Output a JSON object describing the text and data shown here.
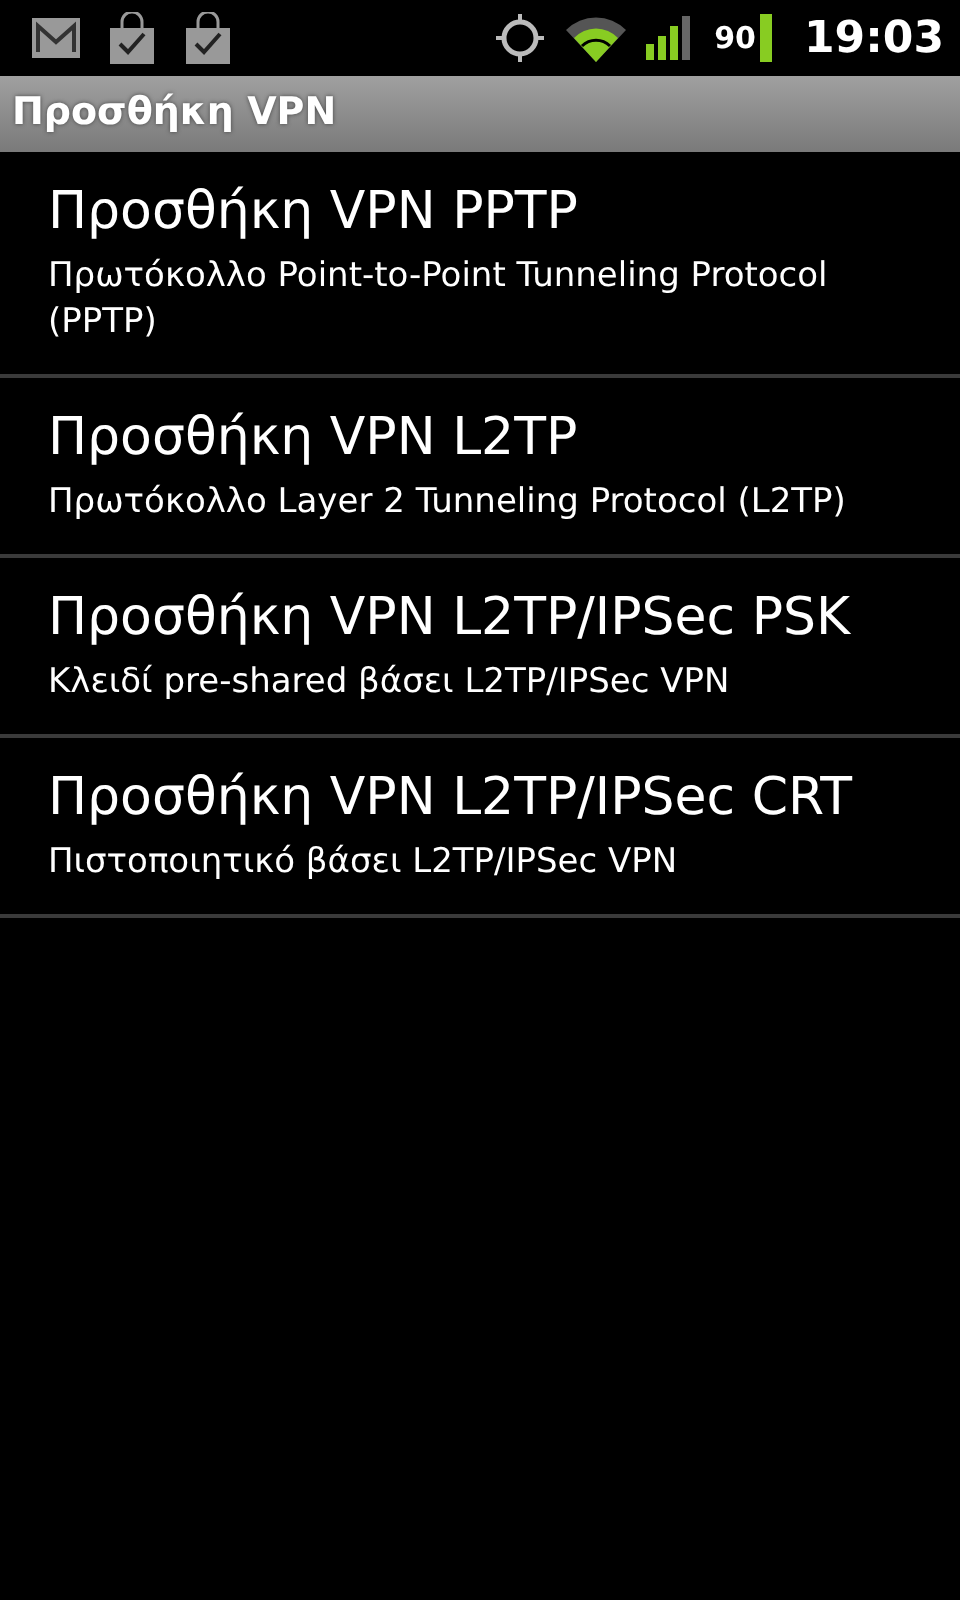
{
  "status_bar": {
    "battery_percent": "90",
    "time": "19:03"
  },
  "title_bar": {
    "title": "Προσθήκη VPN"
  },
  "items": [
    {
      "title": "Προσθήκη VPN PPTP",
      "summary": "Πρωτόκολλο Point-to-Point Tunneling Protocol (PPTP)"
    },
    {
      "title": "Προσθήκη VPN L2TP",
      "summary": "Πρωτόκολλο Layer 2 Tunneling Protocol (L2TP)"
    },
    {
      "title": "Προσθήκη VPN L2TP/IPSec PSK",
      "summary": "Κλειδί pre-shared βάσει L2TP/IPSec VPN"
    },
    {
      "title": "Προσθήκη VPN L2TP/IPSec CRT",
      "summary": "Πιστοποιητικό βάσει L2TP/IPSec VPN"
    }
  ]
}
